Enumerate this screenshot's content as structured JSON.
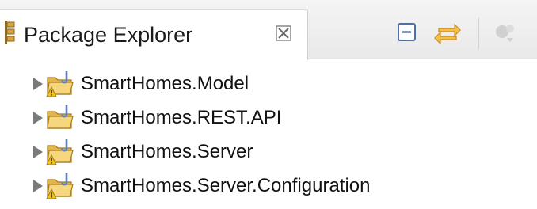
{
  "view": {
    "title": "Package Explorer",
    "icons": {
      "view": "package-explorer-icon",
      "close": "close-icon",
      "collapse": "collapse-all-icon",
      "link": "link-with-editor-icon",
      "menu": "view-menu-icon"
    }
  },
  "tree": {
    "items": [
      {
        "label": "SmartHomes.Model",
        "icon": "java-project-warning-icon",
        "warning": true
      },
      {
        "label": "SmartHomes.REST.API",
        "icon": "java-project-icon",
        "warning": false
      },
      {
        "label": "SmartHomes.Server",
        "icon": "java-project-warning-icon",
        "warning": true
      },
      {
        "label": "SmartHomes.Server.Configuration",
        "icon": "java-project-warning-icon",
        "warning": true
      }
    ]
  },
  "colors": {
    "folder": "#e3b64a",
    "folder_light": "#f6d77e",
    "java_j": "#5a7fc7",
    "warning": "#f2c21b",
    "link_arrow": "#e6a72b",
    "collapse_border": "#4f6fa8"
  }
}
